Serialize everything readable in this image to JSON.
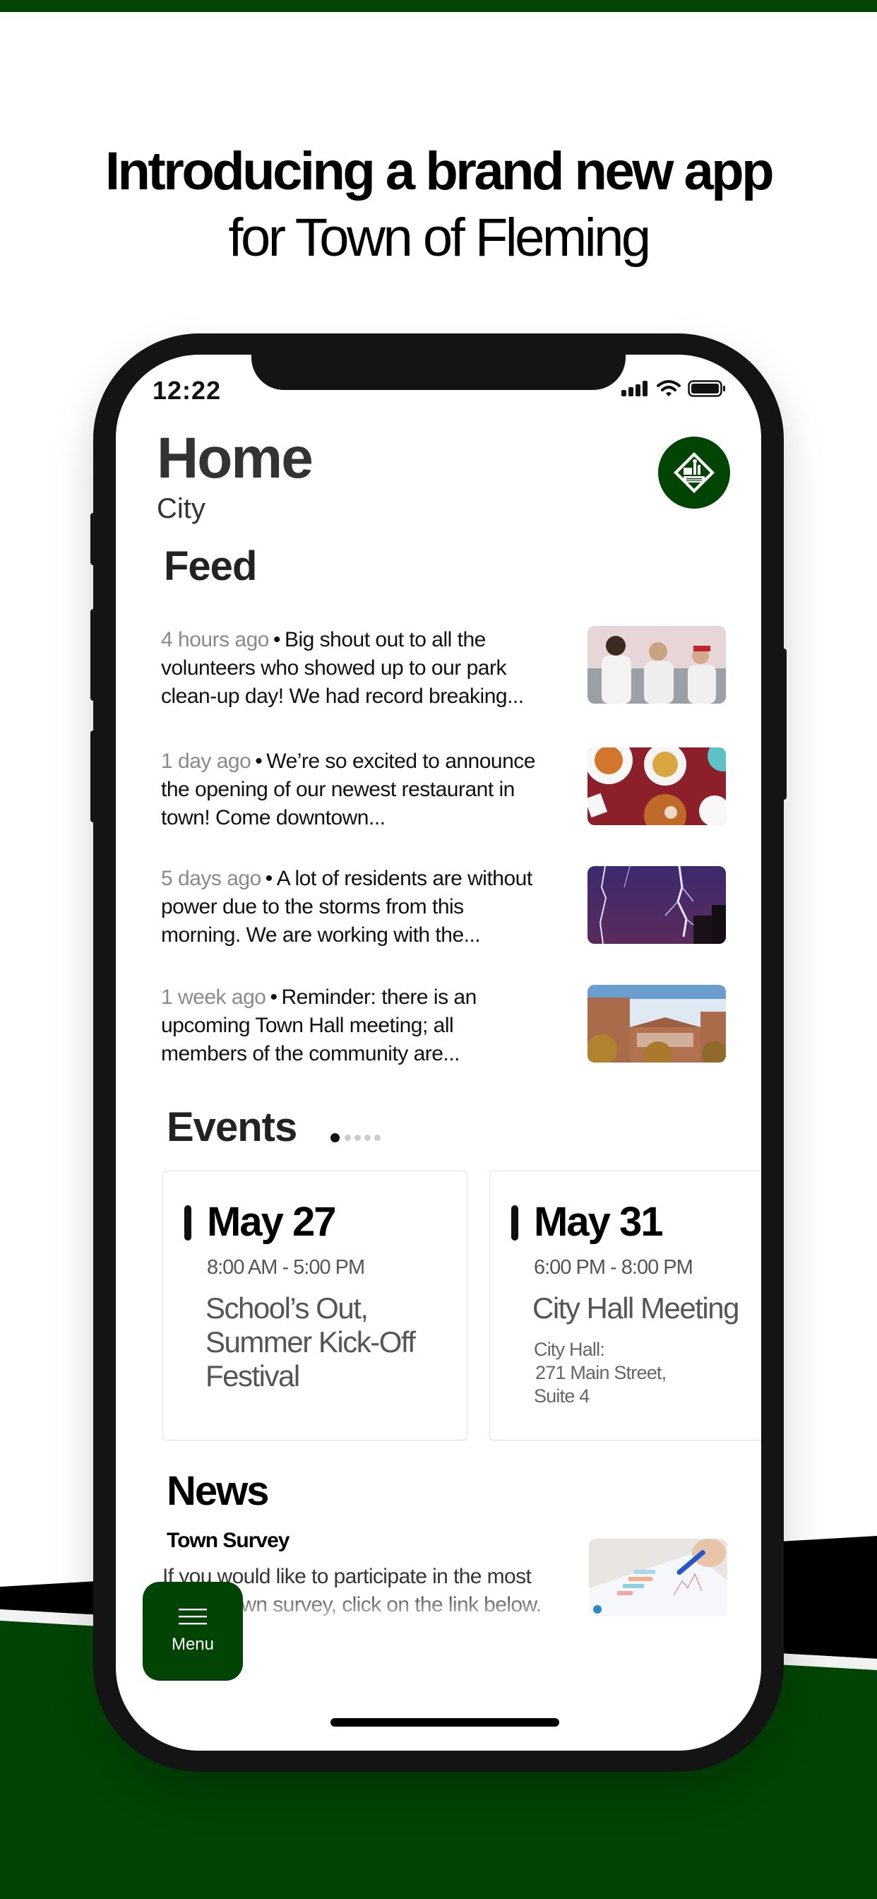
{
  "brand": {
    "accent_color": "#014403",
    "frame_color": "#141414"
  },
  "headline": {
    "line1": "Introducing a brand new app",
    "line2": "for Town of Fleming"
  },
  "status_bar": {
    "time": "12:22",
    "icons": [
      "signal-icon",
      "wifi-icon",
      "battery-icon"
    ]
  },
  "header": {
    "title": "Home",
    "subtitle": "City",
    "logo": "town-of-fleming-seal"
  },
  "feed": {
    "title": "Feed",
    "items": [
      {
        "time": "4 hours ago",
        "text": "Big shout out to all the volunteers who showed up to our park clean-up day! We had record breaking...",
        "image": "volunteers-photo"
      },
      {
        "time": "1 day ago",
        "text": "We’re so excited to announce the opening of our newest restaurant in town! Come downtown...",
        "image": "restaurant-food-photo"
      },
      {
        "time": "5 days ago",
        "text": "A lot of residents are without power due to the storms from this morning. We are working with the...",
        "image": "lightning-storm-photo"
      },
      {
        "time": "1 week ago",
        "text": "Reminder: there is an upcoming Town Hall meeting; all members of the community are...",
        "image": "town-hall-building-photo"
      }
    ]
  },
  "events": {
    "title": "Events",
    "pager": {
      "total": 5,
      "active": 1
    },
    "items": [
      {
        "date": "May 27",
        "time": "8:00 AM - 5:00 PM",
        "name": "School’s Out, Summer Kick-Off Festival",
        "location": ""
      },
      {
        "date": "May 31",
        "time": "6:00 PM - 8:00 PM",
        "name": "City Hall Meeting",
        "location_line1": "City Hall:",
        "location_line2": "271 Main Street,",
        "location_line3": "Suite 4"
      }
    ]
  },
  "news": {
    "title": "News",
    "items": [
      {
        "headline": "Town Survey",
        "text": "If you would like to participate in the most recent town survey, click on the link below.",
        "image": "survey-chart-photo"
      }
    ]
  },
  "menu_button": {
    "label": "Menu",
    "icon": "hamburger-icon"
  }
}
